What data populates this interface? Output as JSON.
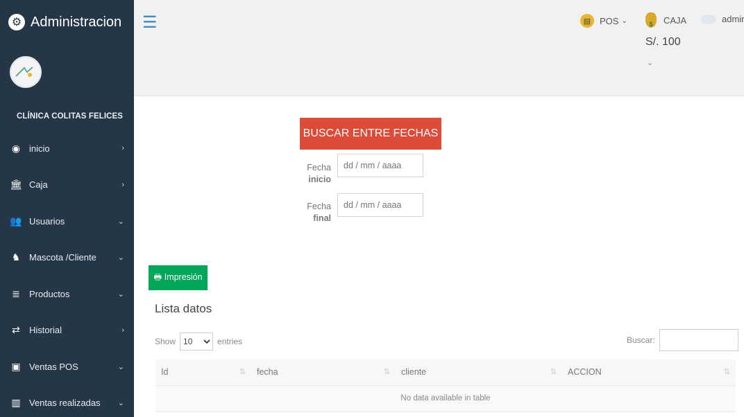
{
  "sidebar": {
    "brand": "Administracion",
    "clinic_name": "CLÍNICA COLITAS FELICES",
    "items": [
      {
        "label": "inicio",
        "icon": "dashboard-icon",
        "chevron": "›"
      },
      {
        "label": "Caja",
        "icon": "bank-icon",
        "chevron": "›"
      },
      {
        "label": "Usuarios",
        "icon": "users-icon",
        "chevron": "⌄"
      },
      {
        "label": "Mascota /Cliente",
        "icon": "pet-client-icon",
        "chevron": "⌄"
      },
      {
        "label": "Productos",
        "icon": "database-icon",
        "chevron": "⌄"
      },
      {
        "label": "Historial",
        "icon": "retweet-icon",
        "chevron": "›"
      },
      {
        "label": "Ventas POS",
        "icon": "money-icon",
        "chevron": "⌄"
      },
      {
        "label": "Ventas realizadas",
        "icon": "bar-chart-icon",
        "chevron": "⌄"
      }
    ]
  },
  "topbar": {
    "pos_label": "POS",
    "caja_label": "CAJA",
    "caja_amount": "S/. 100",
    "admin_label": "admin"
  },
  "form": {
    "search_button": "BUSCAR ENTRE FECHAS",
    "start_label_1": "Fecha",
    "start_label_2": "inicio",
    "end_label_1": "Fecha",
    "end_label_2": "final",
    "date_placeholder": "dd / mm / aaaa"
  },
  "table_section": {
    "print_button": "Impresión",
    "title": "Lista datos",
    "show_label": "Show",
    "entries_label": "entries",
    "page_size": "10",
    "search_label": "Buscar:",
    "columns": [
      "Id",
      "fecha",
      "cliente",
      "ACCION"
    ],
    "empty_message": "No data available in table"
  },
  "colors": {
    "sidebar": "#253746",
    "danger": "#dd4b39",
    "success": "#00a65a",
    "primary": "#3c8dbc"
  }
}
